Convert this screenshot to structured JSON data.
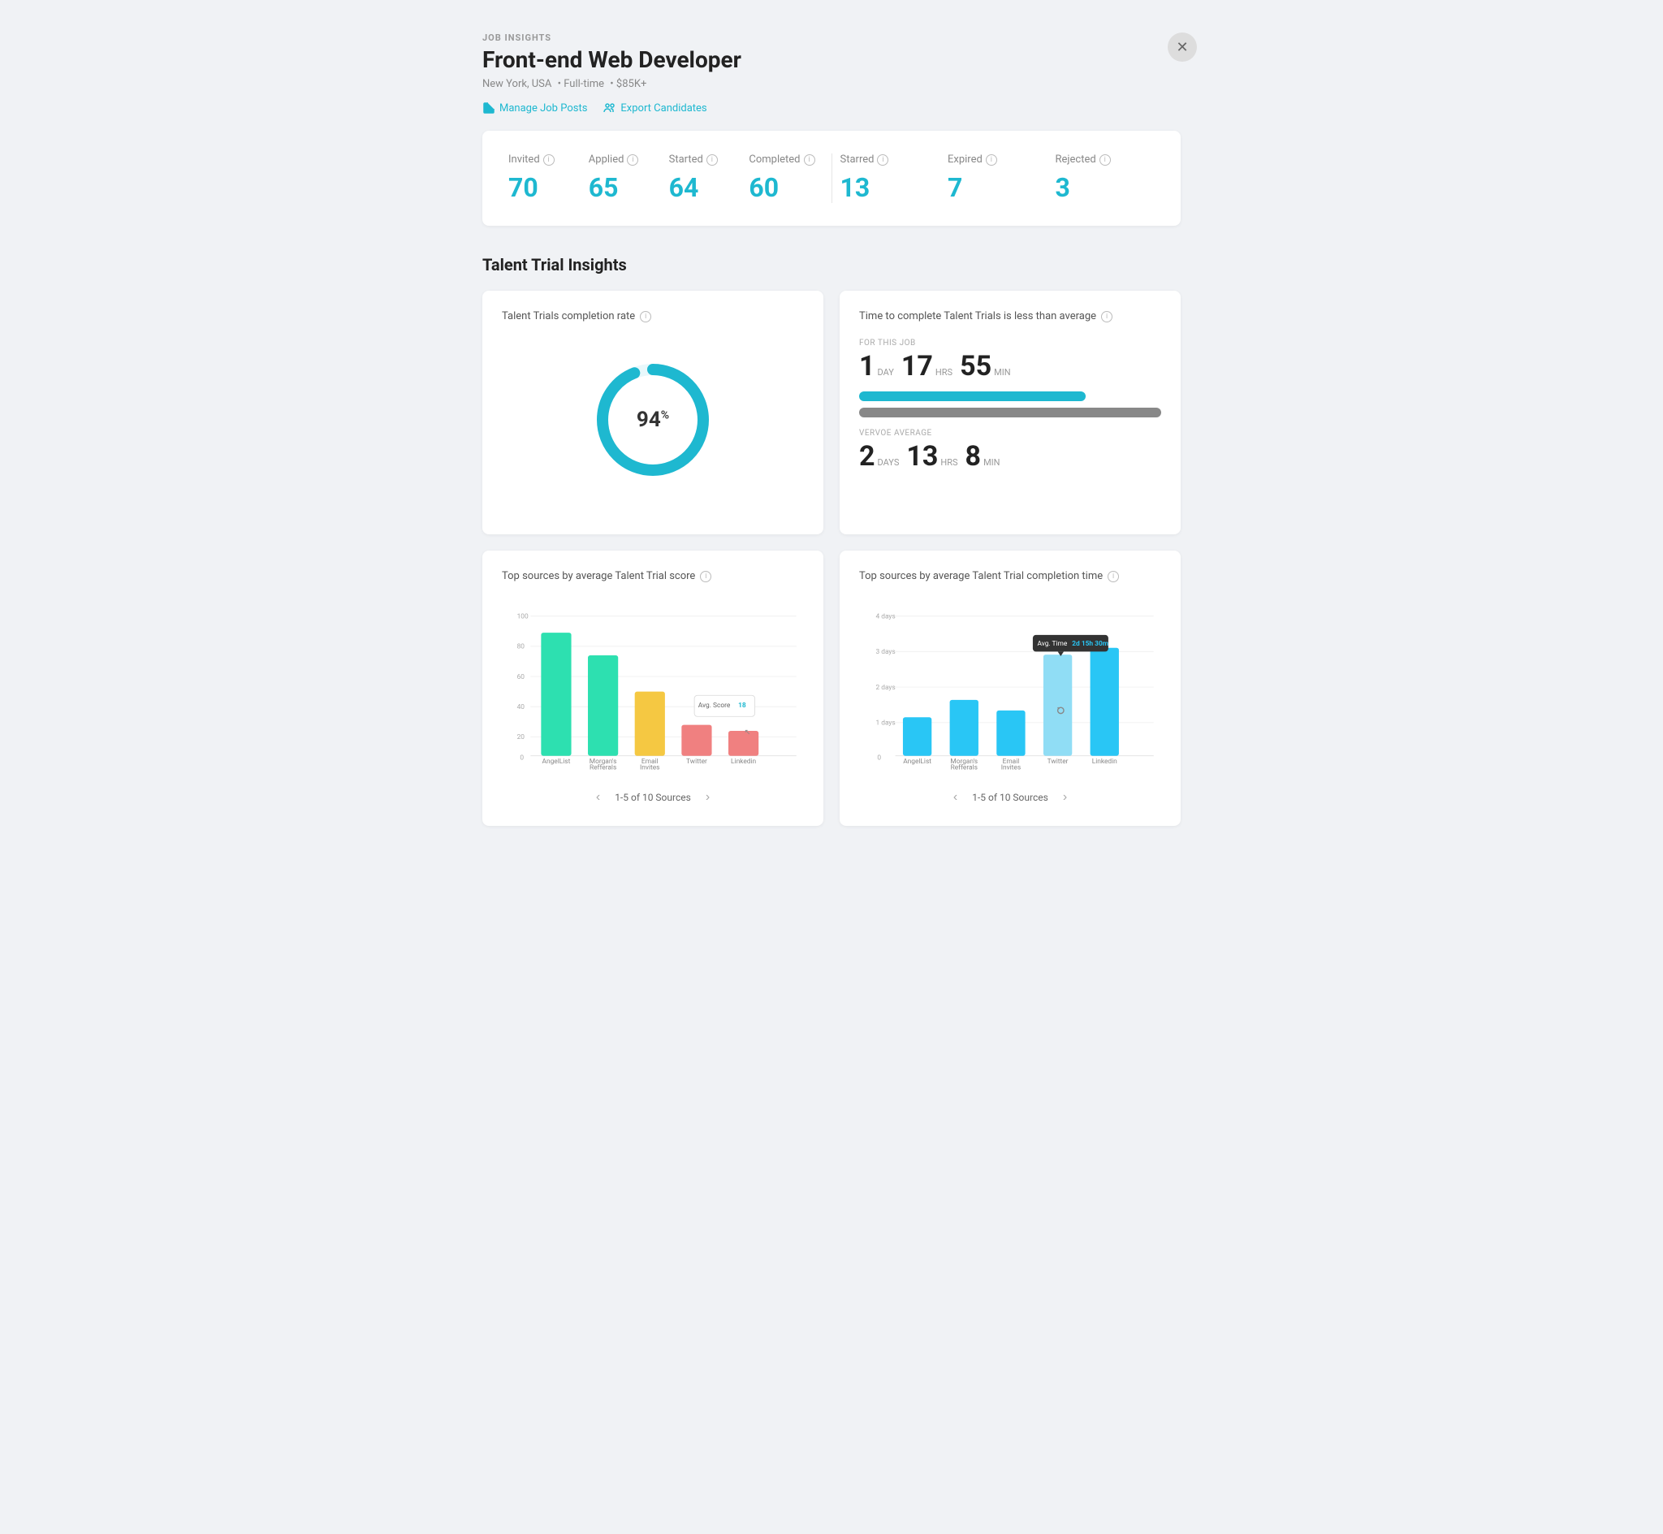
{
  "header": {
    "insights_label": "JOB INSIGHTS",
    "job_title": "Front-end Web Developer",
    "location": "New York, USA",
    "type": "Full-time",
    "salary": "$85K+",
    "manage_posts_label": "Manage Job Posts",
    "export_candidates_label": "Export Candidates"
  },
  "stats": {
    "invited": {
      "label": "Invited",
      "value": "70"
    },
    "applied": {
      "label": "Applied",
      "value": "65"
    },
    "started": {
      "label": "Started",
      "value": "64"
    },
    "completed": {
      "label": "Completed",
      "value": "60"
    },
    "starred": {
      "label": "Starred",
      "value": "13"
    },
    "expired": {
      "label": "Expired",
      "value": "7"
    },
    "rejected": {
      "label": "Rejected",
      "value": "3"
    }
  },
  "talent_trial": {
    "section_title": "Talent Trial Insights",
    "completion_rate_card": {
      "title": "Talent Trials completion rate",
      "value": "94",
      "suffix": "%"
    },
    "time_card": {
      "title": "Time to complete Talent Trials is less than average",
      "for_this_job_label": "FOR THIS JOB",
      "job_days": "1",
      "job_hrs": "17",
      "job_min": "55",
      "vervoe_avg_label": "VERVOE AVERAGE",
      "avg_days": "2",
      "avg_hrs": "13",
      "avg_min": "8"
    },
    "top_score_card": {
      "title": "Top sources by average Talent Trial score",
      "pagination": "1-5 of 10 Sources",
      "sources": [
        "AngelList",
        "Morgan's Refferals",
        "Email Invites",
        "Twitter",
        "Linkedin"
      ],
      "scores": [
        88,
        72,
        46,
        22,
        18
      ],
      "colors": [
        "#2de0b0",
        "#2de0b0",
        "#f5c842",
        "#f08080",
        "#f08080"
      ],
      "tooltip": {
        "label": "Avg. Score",
        "value": "18",
        "bar_index": 4
      },
      "y_axis": [
        0,
        20,
        40,
        60,
        80,
        100
      ]
    },
    "top_time_card": {
      "title": "Top sources by average Talent Trial completion time",
      "pagination": "1-5 of 10 Sources",
      "sources": [
        "AngelList",
        "Morgan's Refferals",
        "Email Invites",
        "Twitter",
        "Linkedin"
      ],
      "values_days": [
        1.1,
        1.6,
        1.3,
        2.9,
        3.1
      ],
      "tooltip": {
        "label": "Avg. Time",
        "value": "2d 15h 30m",
        "bar_index": 3
      },
      "y_axis_labels": [
        "0",
        "1 days",
        "2 days",
        "3 days",
        "4 days"
      ],
      "colors": [
        "#29c6f5",
        "#29c6f5",
        "#29c6f5",
        "#90ddf5",
        "#29c6f5"
      ]
    }
  },
  "icons": {
    "close": "✕",
    "info": "i",
    "link": "🔗",
    "export": "👥",
    "chevron_left": "‹",
    "chevron_right": "›"
  }
}
